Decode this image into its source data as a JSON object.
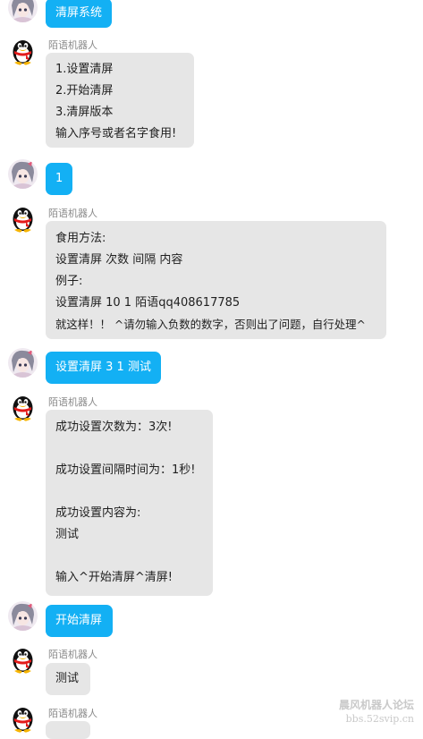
{
  "chat": {
    "bot_name": "陌语机器人",
    "m1": {
      "text": "清屏系统"
    },
    "m2": {
      "lines": [
        "1.设置清屏",
        "2.开始清屏",
        "3.清屏版本",
        "输入序号或者名字食用!"
      ]
    },
    "m3": {
      "text": "1"
    },
    "m4": {
      "lines": [
        "食用方法:",
        "设置清屏 次数 间隔 内容",
        "例子:",
        "设置清屏 10 1 陌语qq408617785",
        "就这样！！ ^请勿输入负数的数字，否则出了问题，自行处理^"
      ]
    },
    "m5": {
      "text": "设置清屏 3 1 测试"
    },
    "m6": {
      "lines": [
        "成功设置次数为：3次!",
        "",
        "成功设置间隔时间为：1秒!",
        "",
        "成功设置内容为:",
        "测试",
        "",
        "输入^开始清屏^清屏!"
      ]
    },
    "m7": {
      "text": "开始清屏"
    },
    "m8": {
      "text": "测试"
    }
  },
  "watermark": {
    "title": "晨风机器人论坛",
    "url": "bbs.52svip.cn"
  },
  "colors": {
    "user_bubble": "#13b0f4",
    "bot_bubble": "#e6e6e6"
  }
}
